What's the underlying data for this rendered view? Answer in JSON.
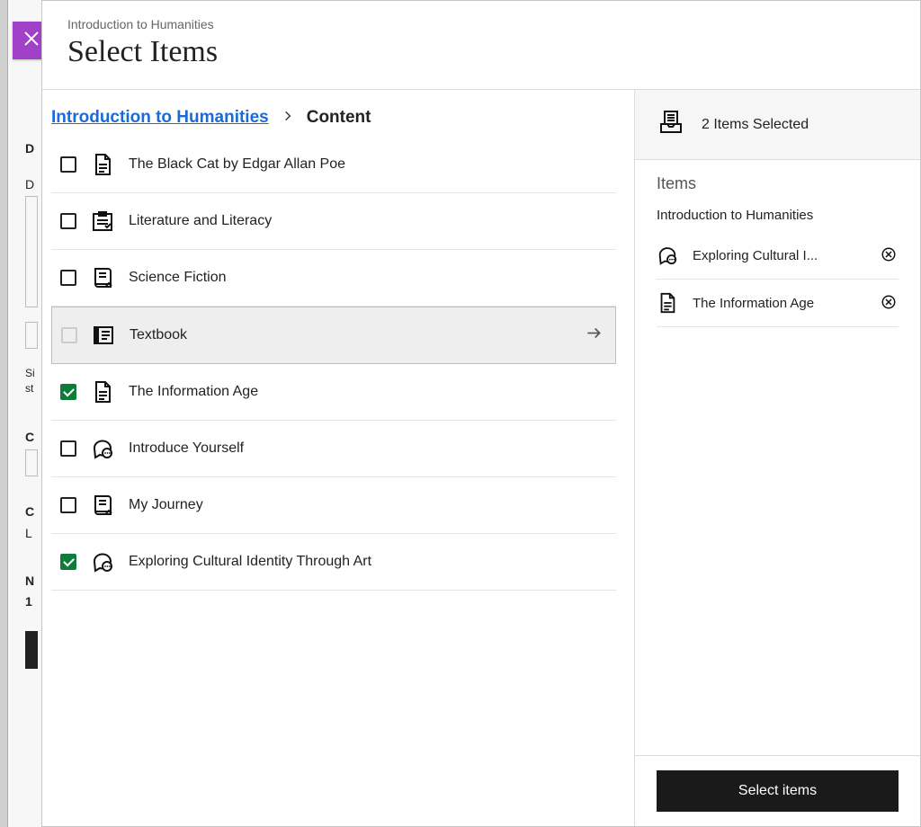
{
  "header": {
    "subtitle": "Introduction to Humanities",
    "title": "Select Items"
  },
  "breadcrumb": {
    "root_label": "Introduction to Humanities",
    "current_label": "Content"
  },
  "items": [
    {
      "label": "The Black Cat by Edgar Allan Poe",
      "icon": "document",
      "checked": false,
      "folder": false
    },
    {
      "label": "Literature and Literacy",
      "icon": "assignment",
      "checked": false,
      "folder": false
    },
    {
      "label": "Science Fiction",
      "icon": "journal",
      "checked": false,
      "folder": false
    },
    {
      "label": "Textbook",
      "icon": "textbook",
      "checked": false,
      "folder": true,
      "active": true
    },
    {
      "label": "The Information Age",
      "icon": "document",
      "checked": true,
      "folder": false
    },
    {
      "label": "Introduce Yourself",
      "icon": "discussion",
      "checked": false,
      "folder": false
    },
    {
      "label": "My Journey",
      "icon": "journal",
      "checked": false,
      "folder": false
    },
    {
      "label": "Exploring Cultural Identity Through Art",
      "icon": "discussion",
      "checked": true,
      "folder": false
    }
  ],
  "selection": {
    "summary_label": "2 Items Selected",
    "section_title": "Items",
    "group_title": "Introduction to Humanities",
    "selected": [
      {
        "label": "Exploring Cultural I...",
        "icon": "discussion"
      },
      {
        "label": "The Information Age",
        "icon": "document"
      }
    ]
  },
  "footer": {
    "submit_label": "Select items"
  },
  "background_fragments": {
    "d1": "D",
    "d2": "D",
    "s1": "Si",
    "s2": "st",
    "c1": "C",
    "c2": "C",
    "l1": "L",
    "n1": "N",
    "n2": "1"
  }
}
